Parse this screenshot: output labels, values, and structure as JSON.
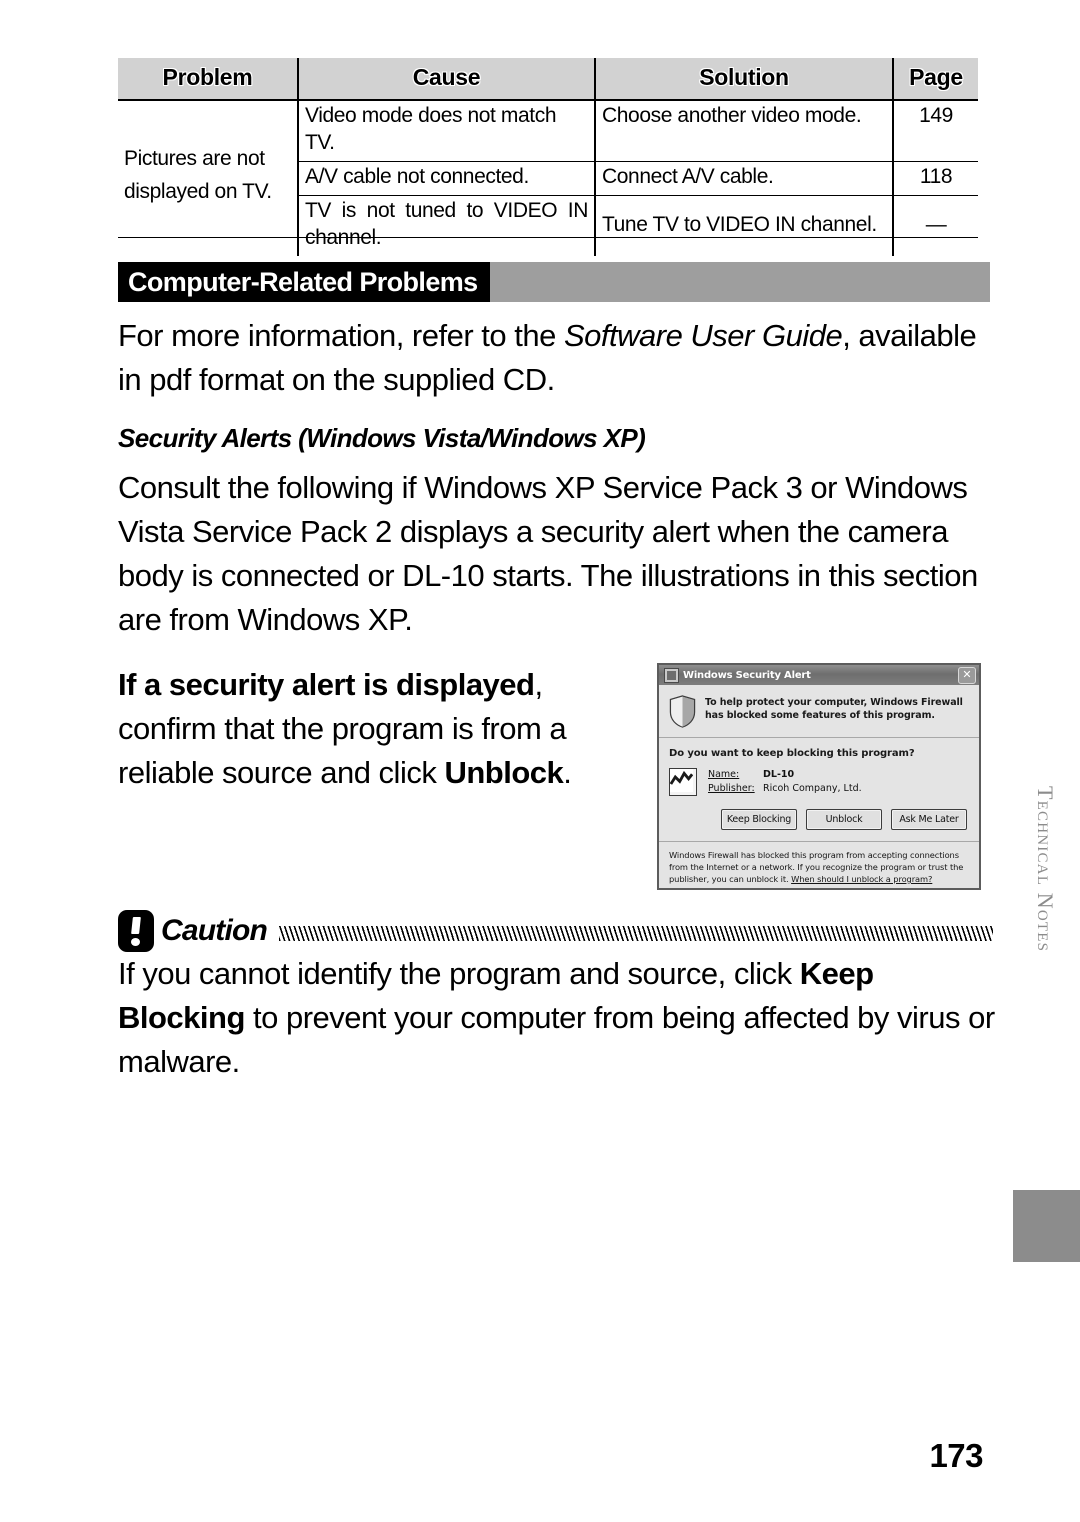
{
  "table": {
    "headers": [
      "Problem",
      "Cause",
      "Solution",
      "Page"
    ],
    "problem": "Pictures are not displayed on TV.",
    "rows": [
      {
        "cause": "Video mode does not match TV.",
        "solution": "Choose another video mode.",
        "page": "149"
      },
      {
        "cause": "A/V cable not connected.",
        "solution": "Connect A/V cable.",
        "page": "118"
      },
      {
        "cause": "TV is not tuned to VIDEO IN channel.",
        "solution": "Tune TV to VIDEO IN channel.",
        "page": "—"
      }
    ]
  },
  "section": {
    "banner_title": "Computer-Related Problems",
    "intro_before": "For more information, refer to the ",
    "intro_italic": "Software User Guide",
    "intro_after": ", available in pdf format on the supplied CD."
  },
  "subsection": {
    "heading": "Security Alerts (Windows Vista/Windows XP)",
    "body": "Consult the following if Windows XP Service Pack 3 or Windows Vista Service Pack 2 displays a security alert when the camera body is connected or DL-10 starts. The illustrations in this section are from Windows XP."
  },
  "alert_para": {
    "bold_1": "If a security alert is displayed",
    "mid": ", confirm that the program is from a reliable source and click ",
    "bold_2": "Unblock",
    "end": "."
  },
  "dialog": {
    "title": "Windows Security Alert",
    "close_label": "✕",
    "banner_text": "To help protect your computer, Windows Firewall has blocked some features of this program.",
    "question": "Do you want to keep blocking this program?",
    "name_label": "Name:",
    "name_value": "DL-10",
    "publisher_label": "Publisher:",
    "publisher_value": "Ricoh Company, Ltd.",
    "buttons": [
      "Keep Blocking",
      "Unblock",
      "Ask Me Later"
    ],
    "footer_text": "Windows Firewall has blocked this program from accepting connections from the Internet or a network. If you recognize the program or trust the publisher, you can unblock it. ",
    "footer_link": "When should I unblock a program?"
  },
  "caution": {
    "label": "Caution",
    "bold_1": "Keep Blocking",
    "text_before": "If you cannot identify the program and source, click ",
    "text_after": " to prevent your computer from being affected by virus or malware."
  },
  "sidetab": {
    "label": "Technical Notes"
  },
  "footer": {
    "page_number": "173"
  },
  "colors": {
    "banner_gray": "#9e9e9e",
    "table_header_gray": "#d2d2d2",
    "sidetab_gray": "#8c8c8c"
  }
}
